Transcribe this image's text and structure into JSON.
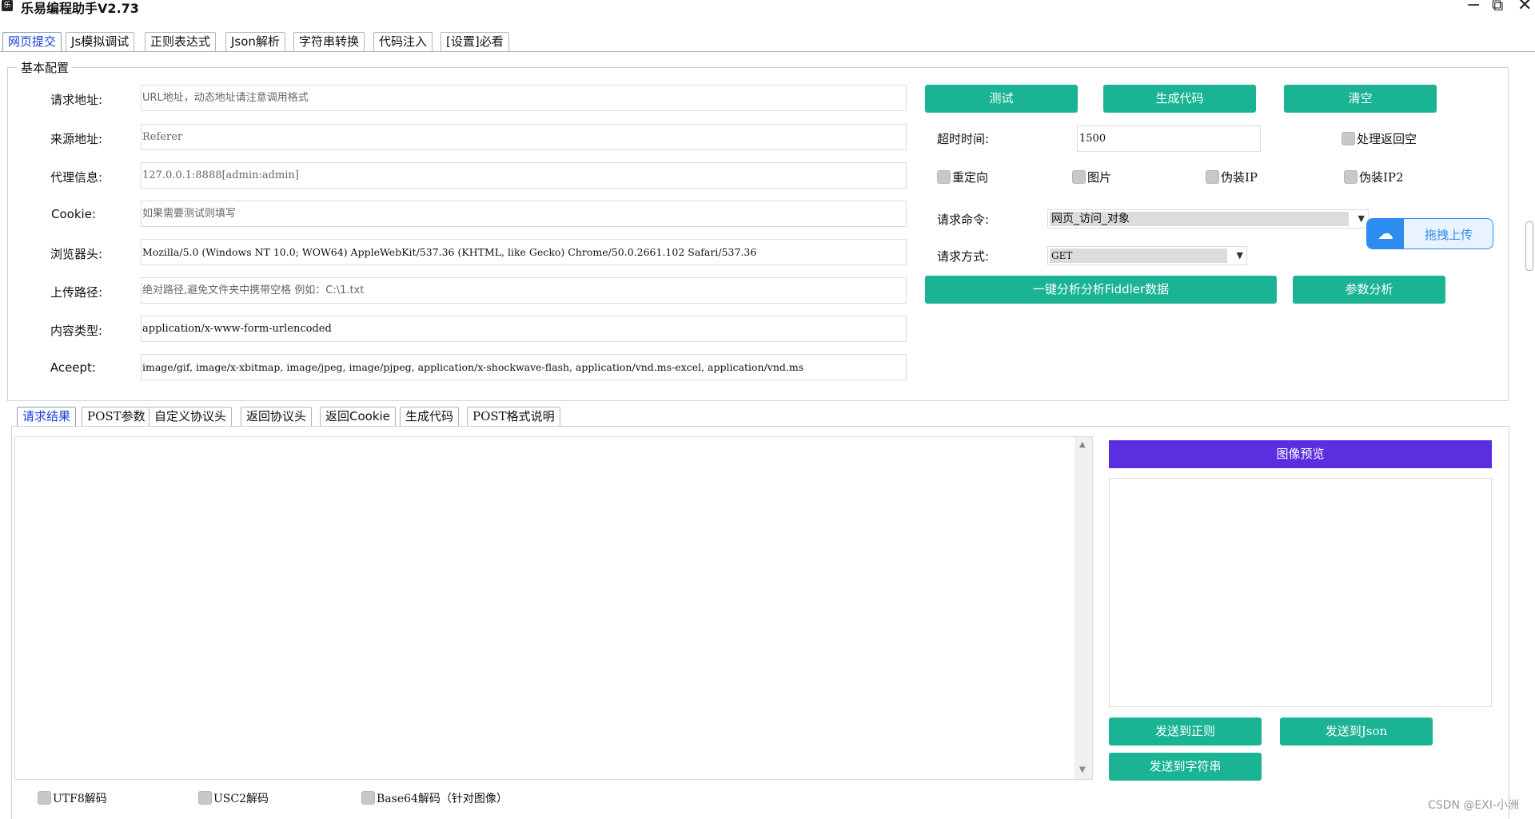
{
  "window": {
    "title": "乐易编程助手V2.73",
    "min": "−",
    "max": "⧉",
    "close": "✕"
  },
  "main_tabs": [
    "网页提交",
    "Js模拟调试",
    "正则表达式",
    "Json解析",
    "字符串转换",
    "代码注入",
    "[设置]必看"
  ],
  "config": {
    "group_title": "基本配置",
    "fields": [
      {
        "label": "请求地址:",
        "value": "URL地址，动态地址请注意调用格式",
        "placeholder": true
      },
      {
        "label": "来源地址:",
        "value": "Referer",
        "placeholder": true
      },
      {
        "label": "代理信息:",
        "value": "127.0.0.1:8888[admin:admin]",
        "placeholder": true
      },
      {
        "label": "Cookie:",
        "value": "如果需要测试则填写",
        "placeholder": true
      },
      {
        "label": "浏览器头:",
        "value": "Mozilla/5.0 (Windows NT 10.0; WOW64) AppleWebKit/537.36 (KHTML, like Gecko) Chrome/50.0.2661.102 Safari/537.36",
        "placeholder": false
      },
      {
        "label": "上传路径:",
        "value": "绝对路径,避免文件夹中携带空格 例如：C:\\1.txt",
        "placeholder": true
      },
      {
        "label": "内容类型:",
        "value": "application/x-www-form-urlencoded",
        "placeholder": false
      },
      {
        "label": "Aceept:",
        "value": "image/gif, image/x-xbitmap, image/jpeg, image/pjpeg, application/x-shockwave-flash, application/vnd.ms-excel, application/vnd.ms",
        "placeholder": false
      }
    ],
    "buttons": {
      "test": "测试",
      "gen_code": "生成代码",
      "clear": "清空",
      "analyze_fiddler": "一键分析分析Fiddler数据",
      "param_analysis": "参数分析"
    },
    "timeout_label": "超时时间:",
    "timeout_value": "1500",
    "checkboxes": {
      "handle_empty": "处理返回空",
      "redirect": "重定向",
      "image": "图片",
      "fake_ip": "伪装IP",
      "fake_ip2": "伪装IP2"
    },
    "command_label": "请求命令:",
    "command_value": "网页_访问_对象",
    "method_label": "请求方式:",
    "method_value": "GET",
    "upload_label": "拖拽上传"
  },
  "result_tabs": [
    "请求结果",
    "POST参数",
    "自定义协议头",
    "返回协议头",
    "返回Cookie",
    "生成代码",
    "POST格式说明"
  ],
  "result": {
    "preview_title": "图像预览",
    "send_regex": "发送到正则",
    "send_json": "发送到Json",
    "send_string": "发送到字符串",
    "decode": {
      "utf8": "UTF8解码",
      "usc2": "USC2解码",
      "base64": "Base64解码（针对图像）"
    }
  },
  "watermark": "CSDN @EXI-小洲"
}
